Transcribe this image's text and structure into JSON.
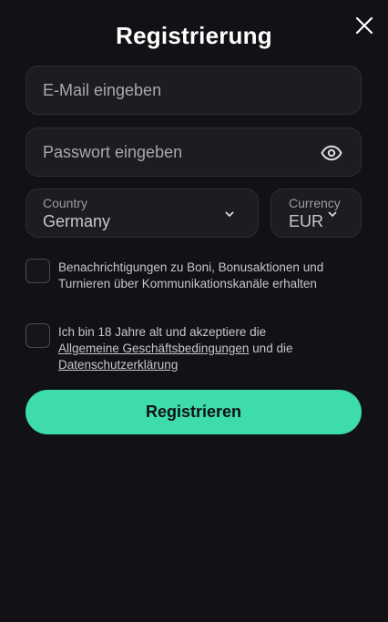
{
  "modal": {
    "title": "Registrierung"
  },
  "form": {
    "email_placeholder": "E-Mail eingeben",
    "password_placeholder": "Passwort eingeben",
    "country": {
      "label": "Country",
      "value": "Germany"
    },
    "currency": {
      "label": "Currency",
      "value": "EUR"
    },
    "consent_bonus": "Benachrichtigungen zu Boni, Bonusaktionen und Turnieren über Kommunikationskanäle erhalten",
    "consent_terms": {
      "prefix": "Ich bin 18 Jahre alt und akzeptiere die",
      "terms_link": "Allgemeine Geschäftsbedingungen",
      "middle": "und die",
      "privacy_link": "Datenschutzerklärung"
    },
    "submit_label": "Registrieren"
  },
  "icons": {
    "close": "close-icon",
    "eye": "eye-icon",
    "chevron": "chevron-down-icon"
  },
  "colors": {
    "background": "#121216",
    "field_bg": "#1d1c21",
    "accent": "#3ddcaa"
  }
}
